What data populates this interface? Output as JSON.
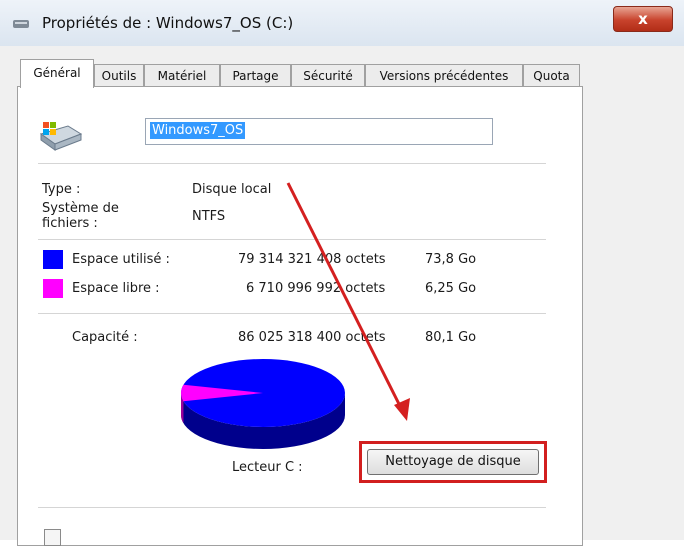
{
  "window": {
    "title": "Propriétés de : Windows7_OS (C:)",
    "close_label": "x"
  },
  "tabs": [
    {
      "label": "Général",
      "active": true
    },
    {
      "label": "Outils"
    },
    {
      "label": "Matériel"
    },
    {
      "label": "Partage"
    },
    {
      "label": "Sécurité"
    },
    {
      "label": "Versions précédentes"
    },
    {
      "label": "Quota"
    }
  ],
  "drive": {
    "name": "Windows7_OS"
  },
  "info": {
    "type_label": "Type :",
    "type_value": "Disque local",
    "fs_label_line1": "Système de",
    "fs_label_line2": "fichiers :",
    "fs_value": "NTFS"
  },
  "space": {
    "used": {
      "label": "Espace utilisé :",
      "bytes": "79 314 321 408 octets",
      "size": "73,8 Go",
      "color": "#0000ff"
    },
    "free": {
      "label": "Espace libre :",
      "bytes": "6 710 996 992 octets",
      "size": "6,25 Go",
      "color": "#ff00ff"
    },
    "capacity": {
      "label": "Capacité :",
      "bytes": "86 025 318 400 octets",
      "size": "80,1 Go"
    }
  },
  "chart_data": {
    "type": "pie",
    "categories": [
      "Espace utilisé",
      "Espace libre"
    ],
    "values": [
      73.8,
      6.25
    ],
    "colors": [
      "#0000ff",
      "#ff00ff"
    ]
  },
  "drive_label": "Lecteur C :",
  "cleanup_button": "Nettoyage de disque"
}
